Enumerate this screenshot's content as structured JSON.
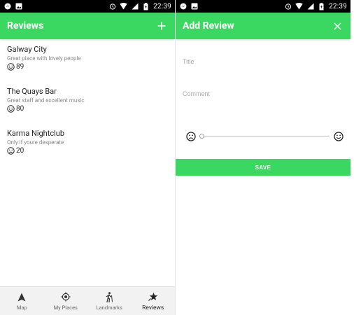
{
  "status_bar": {
    "time": "22:39"
  },
  "reviews_screen": {
    "title": "Reviews",
    "items": [
      {
        "title": "Galway City",
        "comment": "Great place with lovely people",
        "score": "89",
        "mood": "happy"
      },
      {
        "title": "The Quays Bar",
        "comment": "Great staff and excellent music",
        "score": "80",
        "mood": "happy"
      },
      {
        "title": "Karma Nightclub",
        "comment": "Only if youre desperate",
        "score": "20",
        "mood": "sad"
      }
    ],
    "bottom_nav": [
      {
        "label": "Map",
        "icon": "navigation-arrow-icon"
      },
      {
        "label": "My Places",
        "icon": "gps-target-icon"
      },
      {
        "label": "Landmarks",
        "icon": "hiker-icon"
      },
      {
        "label": "Reviews",
        "icon": "star-review-icon",
        "active": true
      }
    ]
  },
  "add_review_screen": {
    "title": "Add Review",
    "title_placeholder": "Title",
    "comment_placeholder": "Comment",
    "rating_value": 0,
    "save_label": "SAVE"
  },
  "colors": {
    "accent": "#3ad861",
    "status_bar": "#000000"
  }
}
